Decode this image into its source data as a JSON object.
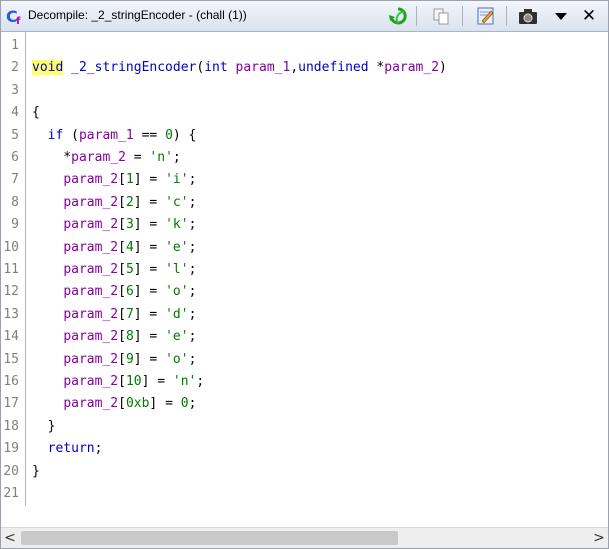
{
  "window": {
    "title": "Decompile: _2_stringEncoder - (chall (1))"
  },
  "toolbar": {
    "icons": [
      "refresh-icon",
      "copy-icon",
      "edit-icon",
      "snapshot-icon",
      "menu-dropdown-icon",
      "close-icon"
    ],
    "close_glyph": "✕"
  },
  "code": {
    "lines": [
      {
        "n": "1",
        "tokens": []
      },
      {
        "n": "2",
        "tokens": [
          {
            "t": "void",
            "c": "kw hl"
          },
          {
            "t": " ",
            "c": "plain"
          },
          {
            "t": "_2_stringEncoder",
            "c": "fn"
          },
          {
            "t": "(",
            "c": "plain"
          },
          {
            "t": "int",
            "c": "kw"
          },
          {
            "t": " ",
            "c": "plain"
          },
          {
            "t": "param_1",
            "c": "var"
          },
          {
            "t": ",",
            "c": "plain"
          },
          {
            "t": "undefined",
            "c": "kw"
          },
          {
            "t": " *",
            "c": "plain"
          },
          {
            "t": "param_2",
            "c": "var"
          },
          {
            "t": ")",
            "c": "plain"
          }
        ]
      },
      {
        "n": "3",
        "tokens": []
      },
      {
        "n": "4",
        "tokens": [
          {
            "t": "{",
            "c": "plain"
          }
        ]
      },
      {
        "n": "5",
        "tokens": [
          {
            "t": "  ",
            "c": "plain"
          },
          {
            "t": "if",
            "c": "kw"
          },
          {
            "t": " (",
            "c": "plain"
          },
          {
            "t": "param_1",
            "c": "var"
          },
          {
            "t": " == ",
            "c": "plain"
          },
          {
            "t": "0",
            "c": "num"
          },
          {
            "t": ") {",
            "c": "plain"
          }
        ]
      },
      {
        "n": "6",
        "tokens": [
          {
            "t": "    *",
            "c": "plain"
          },
          {
            "t": "param_2",
            "c": "var"
          },
          {
            "t": " = ",
            "c": "plain"
          },
          {
            "t": "'n'",
            "c": "str"
          },
          {
            "t": ";",
            "c": "plain"
          }
        ]
      },
      {
        "n": "7",
        "tokens": [
          {
            "t": "    ",
            "c": "plain"
          },
          {
            "t": "param_2",
            "c": "var"
          },
          {
            "t": "[",
            "c": "plain"
          },
          {
            "t": "1",
            "c": "num"
          },
          {
            "t": "] = ",
            "c": "plain"
          },
          {
            "t": "'i'",
            "c": "str"
          },
          {
            "t": ";",
            "c": "plain"
          }
        ]
      },
      {
        "n": "8",
        "tokens": [
          {
            "t": "    ",
            "c": "plain"
          },
          {
            "t": "param_2",
            "c": "var"
          },
          {
            "t": "[",
            "c": "plain"
          },
          {
            "t": "2",
            "c": "num"
          },
          {
            "t": "] = ",
            "c": "plain"
          },
          {
            "t": "'c'",
            "c": "str"
          },
          {
            "t": ";",
            "c": "plain"
          }
        ]
      },
      {
        "n": "9",
        "tokens": [
          {
            "t": "    ",
            "c": "plain"
          },
          {
            "t": "param_2",
            "c": "var"
          },
          {
            "t": "[",
            "c": "plain"
          },
          {
            "t": "3",
            "c": "num"
          },
          {
            "t": "] = ",
            "c": "plain"
          },
          {
            "t": "'k'",
            "c": "str"
          },
          {
            "t": ";",
            "c": "plain"
          }
        ]
      },
      {
        "n": "10",
        "tokens": [
          {
            "t": "    ",
            "c": "plain"
          },
          {
            "t": "param_2",
            "c": "var"
          },
          {
            "t": "[",
            "c": "plain"
          },
          {
            "t": "4",
            "c": "num"
          },
          {
            "t": "] = ",
            "c": "plain"
          },
          {
            "t": "'e'",
            "c": "str"
          },
          {
            "t": ";",
            "c": "plain"
          }
        ]
      },
      {
        "n": "11",
        "tokens": [
          {
            "t": "    ",
            "c": "plain"
          },
          {
            "t": "param_2",
            "c": "var"
          },
          {
            "t": "[",
            "c": "plain"
          },
          {
            "t": "5",
            "c": "num"
          },
          {
            "t": "] = ",
            "c": "plain"
          },
          {
            "t": "'l'",
            "c": "str"
          },
          {
            "t": ";",
            "c": "plain"
          }
        ]
      },
      {
        "n": "12",
        "tokens": [
          {
            "t": "    ",
            "c": "plain"
          },
          {
            "t": "param_2",
            "c": "var"
          },
          {
            "t": "[",
            "c": "plain"
          },
          {
            "t": "6",
            "c": "num"
          },
          {
            "t": "] = ",
            "c": "plain"
          },
          {
            "t": "'o'",
            "c": "str"
          },
          {
            "t": ";",
            "c": "plain"
          }
        ]
      },
      {
        "n": "13",
        "tokens": [
          {
            "t": "    ",
            "c": "plain"
          },
          {
            "t": "param_2",
            "c": "var"
          },
          {
            "t": "[",
            "c": "plain"
          },
          {
            "t": "7",
            "c": "num"
          },
          {
            "t": "] = ",
            "c": "plain"
          },
          {
            "t": "'d'",
            "c": "str"
          },
          {
            "t": ";",
            "c": "plain"
          }
        ]
      },
      {
        "n": "14",
        "tokens": [
          {
            "t": "    ",
            "c": "plain"
          },
          {
            "t": "param_2",
            "c": "var"
          },
          {
            "t": "[",
            "c": "plain"
          },
          {
            "t": "8",
            "c": "num"
          },
          {
            "t": "] = ",
            "c": "plain"
          },
          {
            "t": "'e'",
            "c": "str"
          },
          {
            "t": ";",
            "c": "plain"
          }
        ]
      },
      {
        "n": "15",
        "tokens": [
          {
            "t": "    ",
            "c": "plain"
          },
          {
            "t": "param_2",
            "c": "var"
          },
          {
            "t": "[",
            "c": "plain"
          },
          {
            "t": "9",
            "c": "num"
          },
          {
            "t": "] = ",
            "c": "plain"
          },
          {
            "t": "'o'",
            "c": "str"
          },
          {
            "t": ";",
            "c": "plain"
          }
        ]
      },
      {
        "n": "16",
        "tokens": [
          {
            "t": "    ",
            "c": "plain"
          },
          {
            "t": "param_2",
            "c": "var"
          },
          {
            "t": "[",
            "c": "plain"
          },
          {
            "t": "10",
            "c": "num"
          },
          {
            "t": "] = ",
            "c": "plain"
          },
          {
            "t": "'n'",
            "c": "str"
          },
          {
            "t": ";",
            "c": "plain"
          }
        ]
      },
      {
        "n": "17",
        "tokens": [
          {
            "t": "    ",
            "c": "plain"
          },
          {
            "t": "param_2",
            "c": "var"
          },
          {
            "t": "[",
            "c": "plain"
          },
          {
            "t": "0xb",
            "c": "num"
          },
          {
            "t": "] = ",
            "c": "plain"
          },
          {
            "t": "0",
            "c": "num"
          },
          {
            "t": ";",
            "c": "plain"
          }
        ]
      },
      {
        "n": "18",
        "tokens": [
          {
            "t": "  }",
            "c": "plain"
          }
        ]
      },
      {
        "n": "19",
        "tokens": [
          {
            "t": "  ",
            "c": "plain"
          },
          {
            "t": "return",
            "c": "kw"
          },
          {
            "t": ";",
            "c": "plain"
          }
        ]
      },
      {
        "n": "20",
        "tokens": [
          {
            "t": "}",
            "c": "plain"
          }
        ]
      },
      {
        "n": "21",
        "tokens": []
      }
    ]
  },
  "scrollbar": {
    "left_arrow": "<",
    "right_arrow": ">"
  }
}
